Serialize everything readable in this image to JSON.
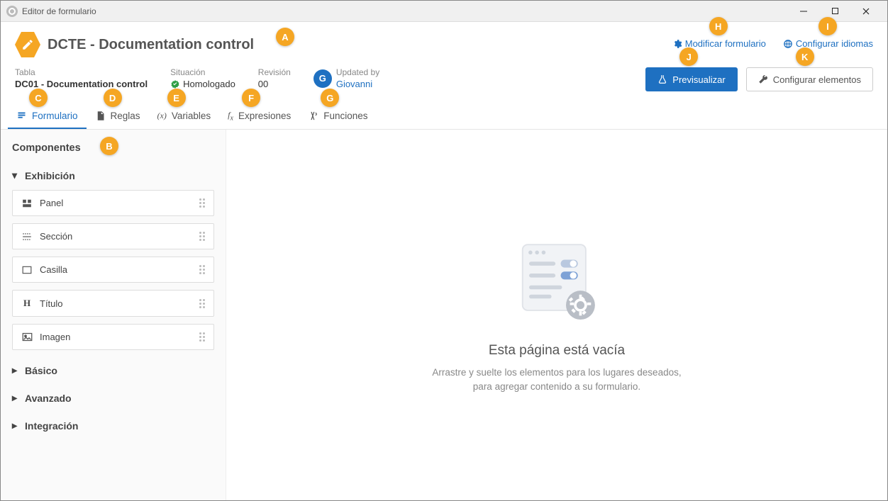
{
  "window": {
    "title": "Editor de formulario"
  },
  "header": {
    "form_title": "DCTE - Documentation control",
    "link_modify": "Modificar formulario",
    "link_languages": "Configurar idiomas"
  },
  "meta": {
    "tabla_label": "Tabla",
    "tabla_value": "DC01 - Documentation control",
    "situacion_label": "Situación",
    "situacion_value": "Homologado",
    "revision_label": "Revisión",
    "revision_value": "00",
    "updated_label": "Updated by",
    "updated_value": "Giovanni",
    "avatar_initial": "G"
  },
  "actions": {
    "preview": "Previsualizar",
    "configure": "Configurar elementos"
  },
  "tabs": {
    "formulario": "Formulario",
    "reglas": "Reglas",
    "variables": "Variables",
    "expresiones": "Expresiones",
    "funciones": "Funciones"
  },
  "sidebar": {
    "title": "Componentes",
    "sections": {
      "exhibicion": "Exhibición",
      "basico": "Básico",
      "avanzado": "Avanzado",
      "integracion": "Integración"
    },
    "components": {
      "panel": "Panel",
      "seccion": "Sección",
      "casilla": "Casilla",
      "titulo": "Título",
      "imagen": "Imagen"
    }
  },
  "canvas": {
    "empty_title": "Esta página está vacía",
    "empty_desc": "Arrastre y suelte los elementos para los lugares deseados, para agregar contenido a su formulario."
  },
  "callouts": {
    "A": "A",
    "B": "B",
    "C": "C",
    "D": "D",
    "E": "E",
    "F": "F",
    "G": "G",
    "H": "H",
    "I": "I",
    "J": "J",
    "K": "K"
  }
}
